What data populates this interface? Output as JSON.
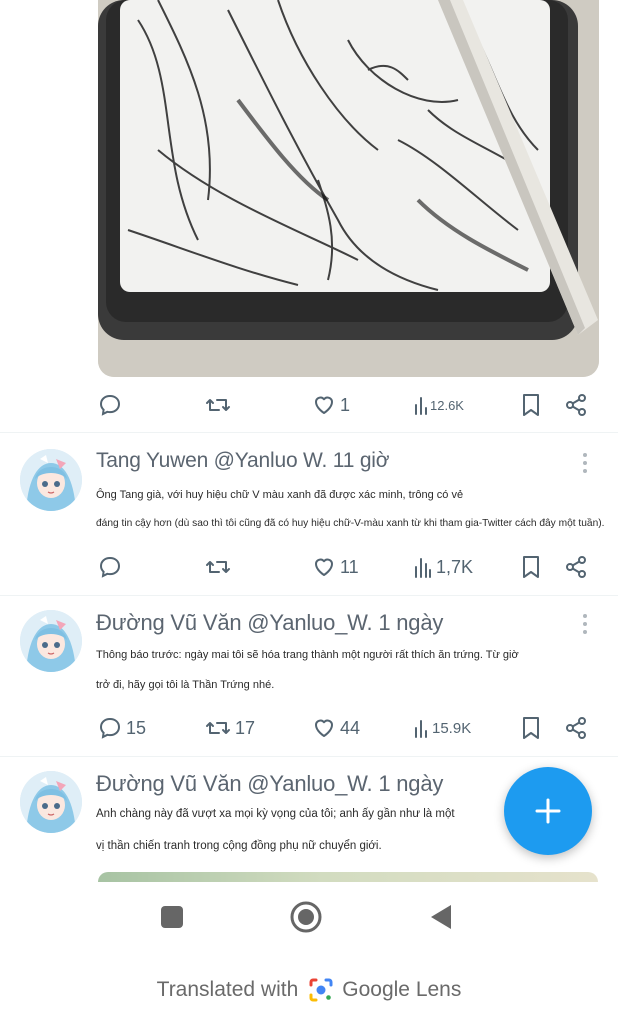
{
  "tweets_actions": [
    {
      "reply": "",
      "retweet": "",
      "like": "1",
      "views": "12.6K"
    },
    {
      "reply": "",
      "retweet": "",
      "like": "11",
      "views": "1,7K"
    },
    {
      "reply": "15",
      "retweet": "17",
      "like": "44",
      "views": "15.9K"
    }
  ],
  "tweets": [
    {
      "header": "Tang Yuwen @Yanluo W. 11 giờ",
      "lines": [
        "Ông Tang già, với huy hiệu chữ V màu xanh đã được xác minh, trông có vẻ",
        "đáng tin cậy hơn (dù sao thì tôi cũng đã có huy hiệu chữ-V-màu xanh từ khi tham gia-Twitter cách đây một tuần)."
      ]
    },
    {
      "header": "Đường Vũ Văn @Yanluo_W. 1 ngày",
      "lines": [
        "Thông báo trước: ngày mai tôi sẽ hóa trang thành một người rất thích ăn trứng. Từ giờ",
        "trở đi, hãy gọi tôi là Thần Trứng nhé."
      ]
    },
    {
      "header": "Đường Vũ Văn @Yanluo_W. 1 ngày",
      "lines": [
        "Anh chàng này đã vượt xa mọi kỳ vọng của tôi; anh ấy gần như là một",
        "vị thần chiến tranh trong cộng đồng phụ nữ chuyển giới."
      ]
    }
  ],
  "lens": {
    "prefix": "Translated with",
    "brand": "Google Lens"
  },
  "colors": {
    "accent": "#1d9bf0",
    "icon_gray": "#536471"
  },
  "icons": [
    "reply-icon",
    "retweet-icon",
    "like-icon",
    "views-icon",
    "bookmark-icon",
    "share-icon",
    "more-icon",
    "compose-plus-icon",
    "nav-recents-icon",
    "nav-home-icon",
    "nav-back-icon",
    "google-lens-icon"
  ]
}
